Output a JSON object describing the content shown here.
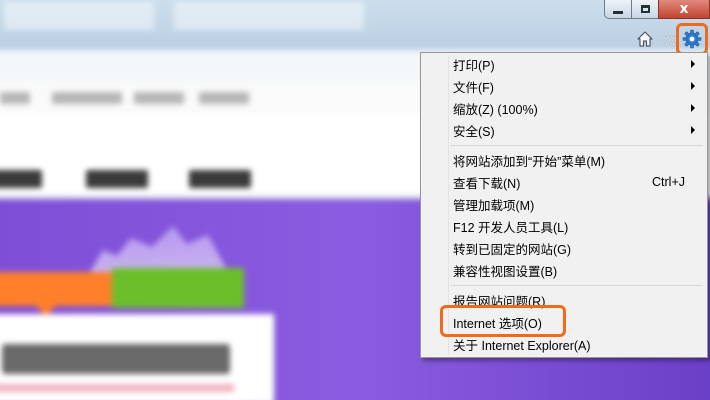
{
  "window_controls": {
    "minimize_icon": "minimize-icon",
    "maximize_icon": "maximize-icon",
    "close_glyph": "x"
  },
  "toolbar": {
    "home_icon": "home-icon",
    "favorites_glyph": "☆",
    "tools_icon": "gear-icon",
    "highlight_color": "#f06a1a"
  },
  "menu": {
    "items": [
      {
        "label": "打印(P)",
        "shortcut": "",
        "submenu": true
      },
      {
        "label": "文件(F)",
        "shortcut": "",
        "submenu": true
      },
      {
        "label": "缩放(Z) (100%)",
        "shortcut": "",
        "submenu": true
      },
      {
        "label": "安全(S)",
        "shortcut": "",
        "submenu": true
      },
      {
        "label": "将网站添加到“开始”菜单(M)",
        "shortcut": "",
        "submenu": false
      },
      {
        "label": "查看下载(N)",
        "shortcut": "Ctrl+J",
        "submenu": false
      },
      {
        "label": "管理加载项(M)",
        "shortcut": "",
        "submenu": false
      },
      {
        "label": "F12 开发人员工具(L)",
        "shortcut": "",
        "submenu": false
      },
      {
        "label": "转到已固定的网站(G)",
        "shortcut": "",
        "submenu": false
      },
      {
        "label": "兼容性视图设置(B)",
        "shortcut": "",
        "submenu": false
      },
      {
        "label": "报告网站问题(R)",
        "shortcut": "",
        "submenu": false
      },
      {
        "label": "Internet 选项(O)",
        "shortcut": "",
        "submenu": false
      },
      {
        "label": "关于 Internet Explorer(A)",
        "shortcut": "",
        "submenu": false
      }
    ]
  }
}
